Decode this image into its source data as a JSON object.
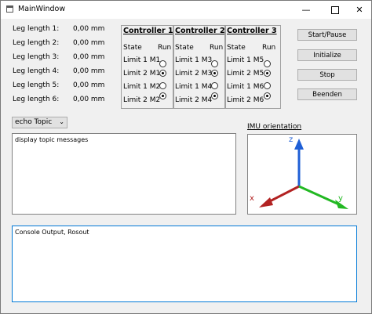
{
  "window": {
    "title": "MainWindow",
    "min_glyph": "—",
    "close_glyph": "✕"
  },
  "legs": [
    {
      "label": "Leg length 1:",
      "value": "0,00 mm"
    },
    {
      "label": "Leg length 2:",
      "value": "0,00 mm"
    },
    {
      "label": "Leg length 3:",
      "value": "0,00 mm"
    },
    {
      "label": "Leg length 4:",
      "value": "0,00 mm"
    },
    {
      "label": "Leg length 5:",
      "value": "0,00 mm"
    },
    {
      "label": "Leg length 6:",
      "value": "0,00 mm"
    }
  ],
  "controllers": [
    {
      "title": "Controller 1",
      "state_label": "State",
      "run_label": "Run",
      "limits": [
        {
          "label": "Limit 1 M1",
          "checked": false
        },
        {
          "label": "Limit 2 M1",
          "checked": true
        },
        {
          "label": "Limit 1 M2",
          "checked": false
        },
        {
          "label": "Limit 2 M2",
          "checked": true
        }
      ]
    },
    {
      "title": "Controller 2",
      "state_label": "State",
      "run_label": "Run",
      "limits": [
        {
          "label": "Limit 1 M3",
          "checked": false
        },
        {
          "label": "Limit 2 M3",
          "checked": true
        },
        {
          "label": "Limit 1 M4",
          "checked": false
        },
        {
          "label": "Limit 2 M4",
          "checked": true
        }
      ]
    },
    {
      "title": "Controller 3",
      "state_label": "State",
      "run_label": "Run",
      "limits": [
        {
          "label": "Limit 1 M5",
          "checked": false
        },
        {
          "label": "Limit 2 M5",
          "checked": true
        },
        {
          "label": "Limit 1 M6",
          "checked": false
        },
        {
          "label": "Limit 2 M6",
          "checked": true
        }
      ]
    }
  ],
  "buttons": {
    "start_pause": "Start/Pause",
    "initialize": "Initialize",
    "stop": "Stop",
    "beenden": "Beenden"
  },
  "topic": {
    "combo_value": "echo Topic",
    "messages": "display topic messages"
  },
  "imu": {
    "label": "IMU orientation",
    "axes": {
      "x": "x",
      "y": "y",
      "z": "z"
    },
    "colors": {
      "x": "#b22222",
      "y": "#22b822",
      "z": "#1f5fd6"
    }
  },
  "console": {
    "text": "Console Output, Rosout"
  }
}
